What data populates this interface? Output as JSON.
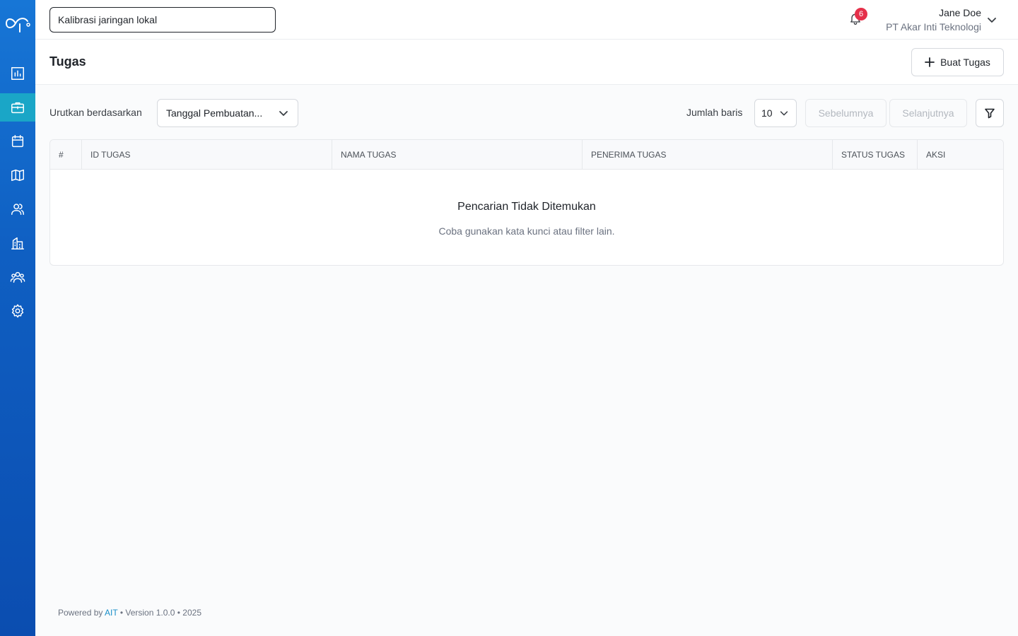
{
  "search": {
    "value": "Kalibrasi jaringan lokal",
    "placeholder": ""
  },
  "notifications": {
    "count": "6",
    "icon": "bell-icon"
  },
  "user": {
    "name": "Jane Doe",
    "organization": "PT Akar Inti Teknologi"
  },
  "sidebar": {
    "items": [
      {
        "icon": "bar-chart-icon",
        "active": false
      },
      {
        "icon": "briefcase-icon",
        "active": true
      },
      {
        "icon": "calendar-icon",
        "active": false
      },
      {
        "icon": "map-icon",
        "active": false
      },
      {
        "icon": "users-icon",
        "active": false
      },
      {
        "icon": "building-icon",
        "active": false
      },
      {
        "icon": "team-icon",
        "active": false
      },
      {
        "icon": "gear-icon",
        "active": false
      }
    ]
  },
  "page": {
    "title": "Tugas",
    "create_label": "Buat Tugas"
  },
  "toolbar": {
    "sort_label": "Urutkan berdasarkan",
    "sort_value": "Tanggal Pembuatan...",
    "rows_label": "Jumlah baris",
    "rows_value": "10",
    "prev_label": "Sebelumnya",
    "next_label": "Selanjutnya"
  },
  "table": {
    "columns": [
      "#",
      "ID TUGAS",
      "NAMA TUGAS",
      "PENERIMA TUGAS",
      "STATUS TUGAS",
      "AKSI"
    ],
    "rows": [],
    "empty_title": "Pencarian Tidak Ditemukan",
    "empty_subtitle": "Coba gunakan kata kunci atau filter lain."
  },
  "footer": {
    "powered_prefix": "Powered by",
    "brand": "AIT",
    "version_text": "• Version 1.0.0 • 2025"
  },
  "colors": {
    "sidebar": "#0f5fc2",
    "active_nav": "#1aa6c7",
    "badge": "#e5304a",
    "link": "#1a8fc9"
  }
}
